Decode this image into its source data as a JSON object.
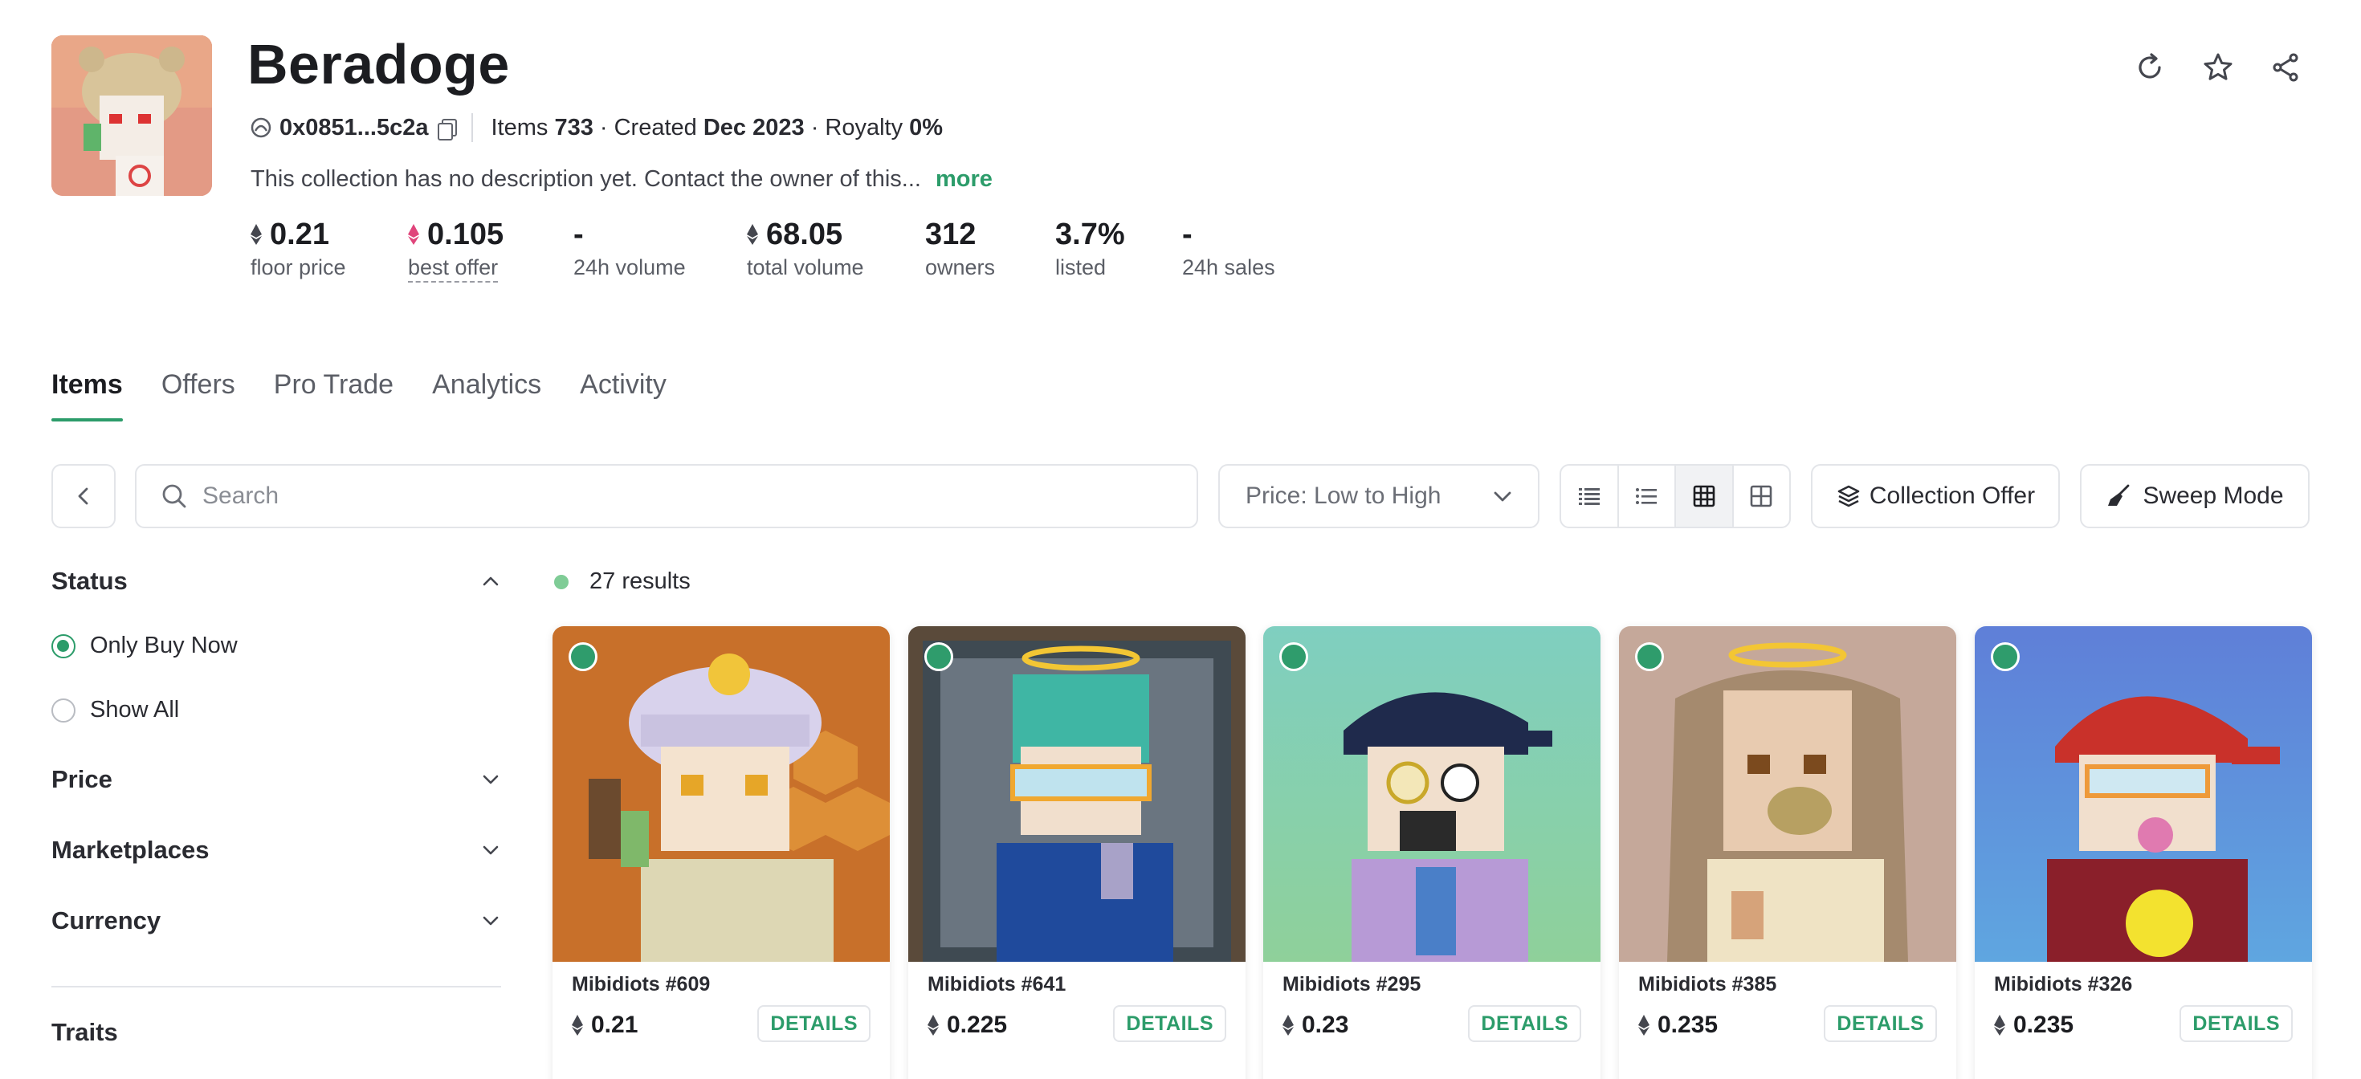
{
  "collection": {
    "name": "Beradoge",
    "address": "0x0851...5c2a",
    "items_label": "Items",
    "items_value": "733",
    "created_label": "· Created",
    "created_value": "Dec 2023",
    "royalty_label": "· Royalty",
    "royalty_value": "0%",
    "description": "This collection has no description yet. Contact the owner of this...",
    "more_link": "more"
  },
  "stats": [
    {
      "value": "0.21",
      "label": "floor price",
      "icon": "eth-icon"
    },
    {
      "value": "0.105",
      "label": "best offer",
      "icon": "weth-icon"
    },
    {
      "value": "-",
      "label": "24h volume"
    },
    {
      "value": "68.05",
      "label": "total volume",
      "icon": "eth-icon"
    },
    {
      "value": "312",
      "label": "owners"
    },
    {
      "value": "3.7%",
      "label": "listed"
    },
    {
      "value": "-",
      "label": "24h sales"
    }
  ],
  "header_actions": [
    "refresh-icon",
    "star-icon",
    "share-icon"
  ],
  "tabs": [
    {
      "label": "Items",
      "active": true
    },
    {
      "label": "Offers"
    },
    {
      "label": "Pro Trade"
    },
    {
      "label": "Analytics"
    },
    {
      "label": "Activity"
    }
  ],
  "toolbar": {
    "search_placeholder": "Search",
    "sort_value": "Price: Low to High",
    "view_modes": [
      "list-detailed-icon",
      "list-icon",
      "grid-small-icon",
      "grid-large-icon"
    ],
    "selected_view": 2,
    "collection_offer": "Collection Offer",
    "sweep_mode": "Sweep Mode"
  },
  "sidebar": {
    "status": {
      "title": "Status",
      "options": [
        {
          "label": "Only Buy Now",
          "selected": true
        },
        {
          "label": "Show All",
          "selected": false
        }
      ]
    },
    "sections": [
      "Price",
      "Marketplaces",
      "Currency"
    ],
    "traits": "Traits"
  },
  "results": {
    "count_text": "27 results"
  },
  "cards": [
    {
      "name": "Mibidiots #609",
      "price": "0.21",
      "details": "DETAILS"
    },
    {
      "name": "Mibidiots #641",
      "price": "0.225",
      "details": "DETAILS"
    },
    {
      "name": "Mibidiots #295",
      "price": "0.23",
      "details": "DETAILS"
    },
    {
      "name": "Mibidiots #385",
      "price": "0.235",
      "details": "DETAILS"
    },
    {
      "name": "Mibidiots #326",
      "price": "0.235",
      "details": "DETAILS"
    }
  ],
  "colors": {
    "accent": "#2c9c6a",
    "text": "#1c1d21",
    "muted": "#5b5e66",
    "border": "#e3e5e9"
  }
}
